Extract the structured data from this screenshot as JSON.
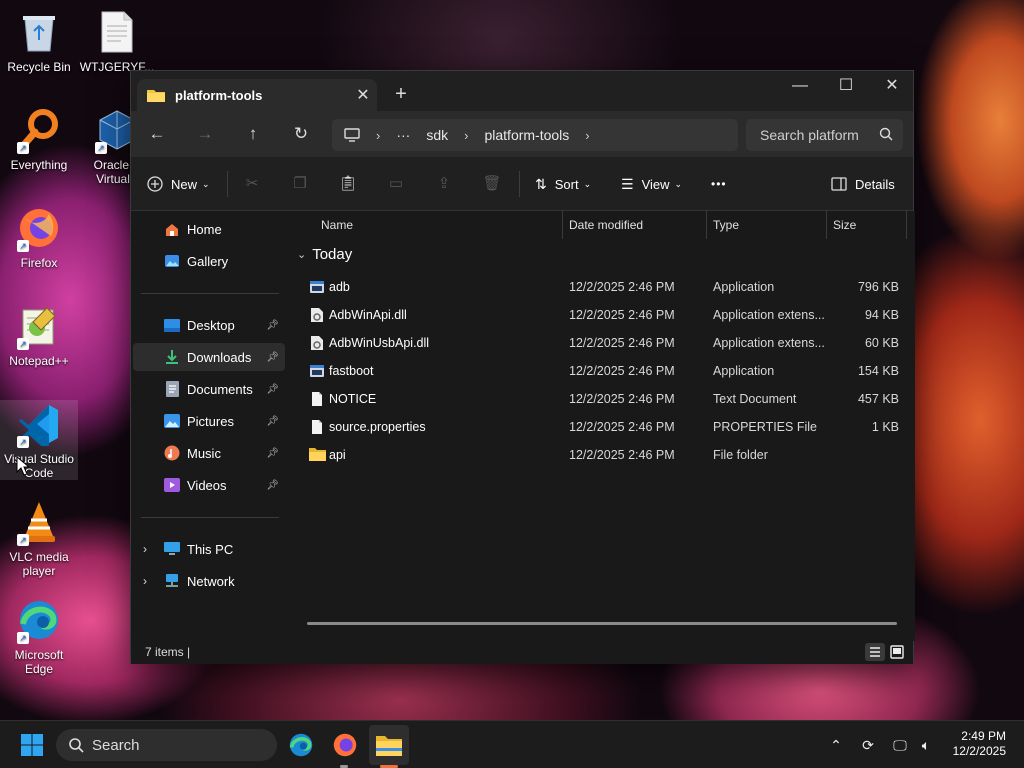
{
  "desktop": {
    "icons": [
      {
        "label": "Recycle Bin"
      },
      {
        "label": "WTJGERYF..."
      },
      {
        "label": "Everything"
      },
      {
        "label": "Oracle V VirtualB"
      },
      {
        "label": "Firefox"
      },
      {
        "label": "Notepad++"
      },
      {
        "label": "Visual Studio Code"
      },
      {
        "label": "VLC media player"
      },
      {
        "label": "Microsoft Edge"
      }
    ]
  },
  "window": {
    "tab_title": "platform-tools",
    "tab_close": "✕",
    "new_tab": "+",
    "controls": {
      "minimize": "—",
      "maximize": "☐",
      "close": "✕"
    },
    "address": {
      "ellipsis": "···",
      "segments": [
        "sdk",
        "platform-tools"
      ]
    },
    "search_placeholder": "Search platform",
    "toolbar": {
      "new": "New",
      "sort": "Sort",
      "view": "View",
      "more": "•••",
      "details": "Details"
    },
    "sidebar": {
      "items": [
        {
          "label": "Home"
        },
        {
          "label": "Gallery"
        },
        {
          "label": "Desktop"
        },
        {
          "label": "Downloads"
        },
        {
          "label": "Documents"
        },
        {
          "label": "Pictures"
        },
        {
          "label": "Music"
        },
        {
          "label": "Videos"
        },
        {
          "label": "This PC"
        },
        {
          "label": "Network"
        }
      ]
    },
    "columns": {
      "name": "Name",
      "date": "Date modified",
      "type": "Type",
      "size": "Size"
    },
    "group": "Today",
    "files": [
      {
        "name": "adb",
        "date": "12/2/2025 2:46 PM",
        "type": "Application",
        "size": "796 KB",
        "icon": "app-icon"
      },
      {
        "name": "AdbWinApi.dll",
        "date": "12/2/2025 2:46 PM",
        "type": "Application extens...",
        "size": "94 KB",
        "icon": "dll-icon"
      },
      {
        "name": "AdbWinUsbApi.dll",
        "date": "12/2/2025 2:46 PM",
        "type": "Application extens...",
        "size": "60 KB",
        "icon": "dll-icon"
      },
      {
        "name": "fastboot",
        "date": "12/2/2025 2:46 PM",
        "type": "Application",
        "size": "154 KB",
        "icon": "app-icon"
      },
      {
        "name": "NOTICE",
        "date": "12/2/2025 2:46 PM",
        "type": "Text Document",
        "size": "457 KB",
        "icon": "file-icon"
      },
      {
        "name": "source.properties",
        "date": "12/2/2025 2:46 PM",
        "type": "PROPERTIES File",
        "size": "1 KB",
        "icon": "file-icon"
      },
      {
        "name": "api",
        "date": "12/2/2025 2:46 PM",
        "type": "File folder",
        "size": "",
        "icon": "folder-icon"
      }
    ],
    "status": "7 items  |"
  },
  "taskbar": {
    "search": "Search",
    "time": "2:49 PM",
    "date": "12/2/2025"
  }
}
